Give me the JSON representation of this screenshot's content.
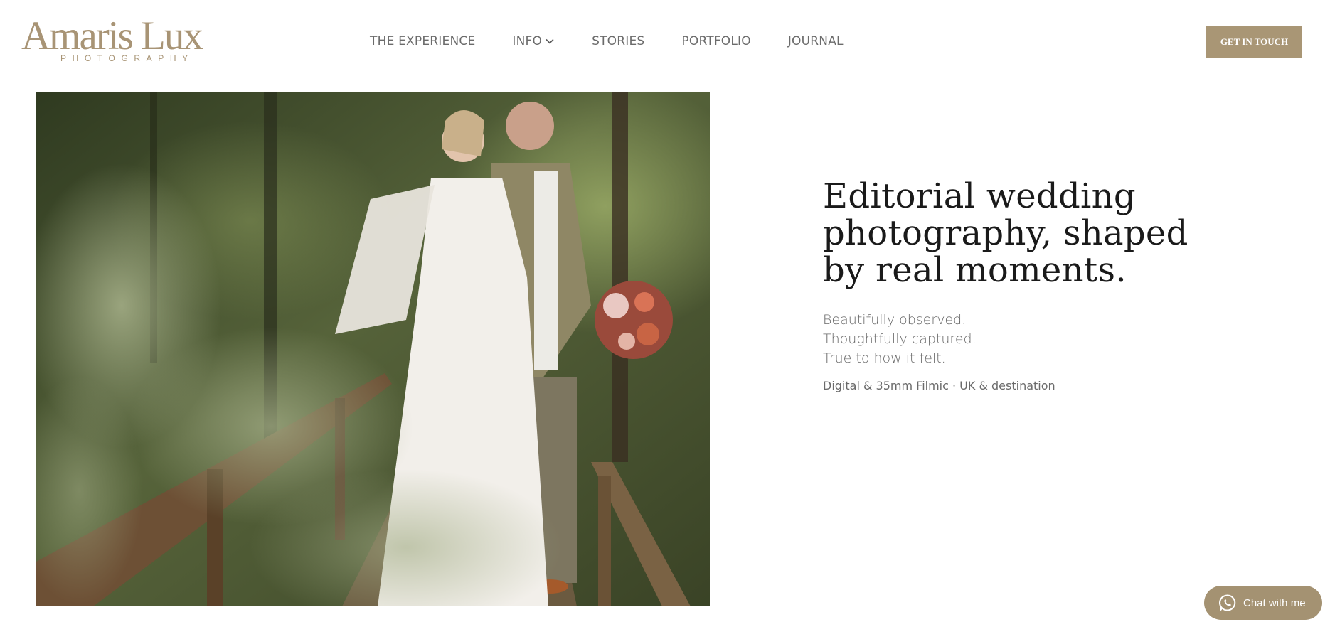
{
  "brand": {
    "name": "Amaris Lux",
    "tagline": "PHOTOGRAPHY",
    "accent_color": "#a99675"
  },
  "nav": {
    "items": [
      {
        "label": "THE EXPERIENCE"
      },
      {
        "label": "INFO",
        "has_dropdown": true
      },
      {
        "label": "STORIES"
      },
      {
        "label": "PORTFOLIO"
      },
      {
        "label": "JOURNAL"
      }
    ],
    "cta_label": "GET IN TOUCH"
  },
  "hero": {
    "headline_lines": [
      "Editorial wedding",
      "photography, shaped",
      "by real moments."
    ],
    "tagline_lines": [
      "Beautifully observed.",
      "Thoughtfully captured.",
      "True to how it felt."
    ],
    "meta": "Digital & 35mm Filmic · UK & destination",
    "image": {
      "subject": "Bride and groom standing on a wooden footbridge in a green forest, groom holding a flower bouquet"
    }
  },
  "chat": {
    "label": "Chat with me",
    "icon": "whatsapp-icon"
  }
}
